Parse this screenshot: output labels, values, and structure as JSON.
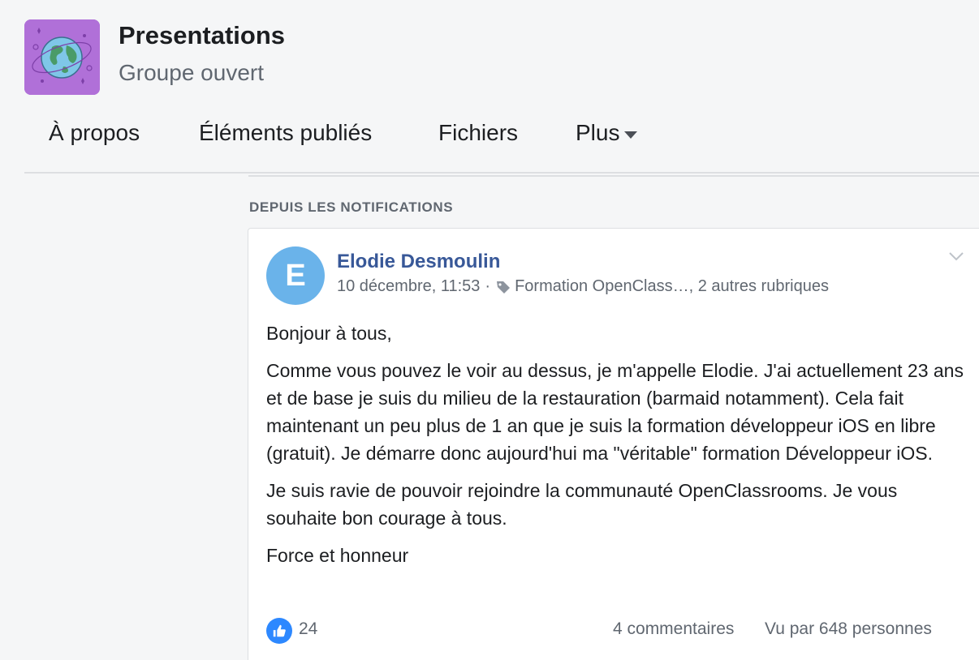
{
  "group": {
    "name": "Presentations",
    "type": "Groupe ouvert",
    "logo_icon": "globe-icon",
    "logo_color": "#b070d8"
  },
  "tabs": [
    {
      "label": "À propos"
    },
    {
      "label": "Éléments publiés"
    },
    {
      "label": "Fichiers"
    },
    {
      "label": "Plus"
    }
  ],
  "section": {
    "label": "DEPUIS LES NOTIFICATIONS"
  },
  "post": {
    "avatar_letter": "E",
    "avatar_color": "#6ab3ea",
    "author": "Elodie Desmoulin",
    "timestamp": "10 décembre, 11:53",
    "separator": "·",
    "topic": "Formation OpenClass…",
    "more_topics": ", 2 autres rubriques",
    "paragraphs": [
      "Bonjour à tous,",
      "Comme vous pouvez le voir au dessus, je m'appelle Elodie. J'ai actuellement 23 ans et de base je suis du milieu de la restauration (barmaid notamment). Cela fait maintenant un peu plus de 1 an que je suis la formation développeur iOS en libre (gratuit). Je démarre donc aujourd'hui ma \"véritable\" formation Développeur iOS.",
      "Je suis ravie de pouvoir rejoindre la communauté OpenClassrooms. Je vous souhaite bon courage à tous.",
      "Force et honneur"
    ],
    "likes": "24",
    "comments": "4 commentaires",
    "seen_by": "Vu par 648 personnes",
    "accent_color": "#385898",
    "like_color": "#2d88ff"
  }
}
